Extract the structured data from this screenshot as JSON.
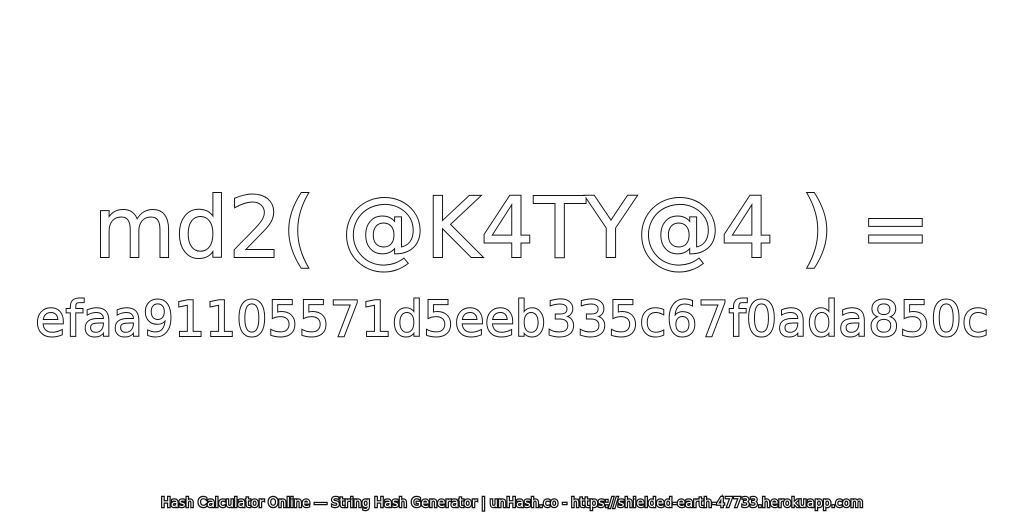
{
  "main": {
    "expression": "md2( @K4TY@4 ) =",
    "hash": "efaa91105571d5eeb335c67f0ada850c"
  },
  "footer": {
    "text": "Hash Calculator Online — String Hash Generator | unHash.co - https://shielded-earth-47733.herokuapp.com"
  },
  "colors": {
    "background": "#ffffff",
    "stroke": "#111111",
    "fill": "#ffffff"
  }
}
